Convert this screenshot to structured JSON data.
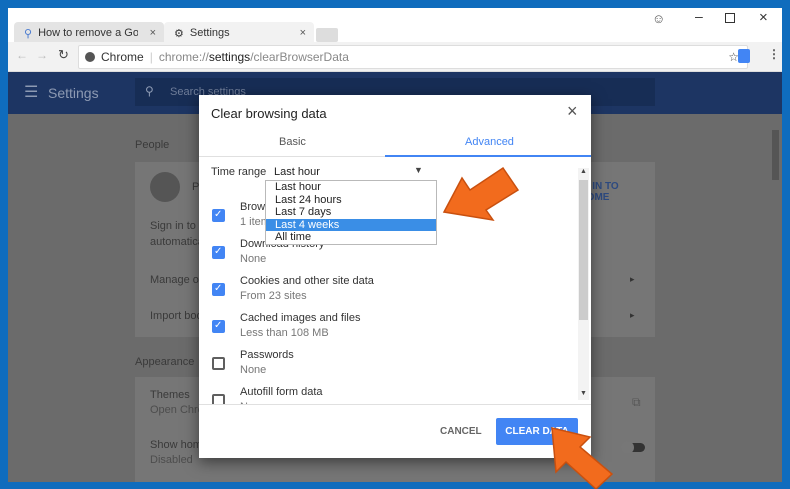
{
  "window": {
    "controls": [
      "account",
      "minimize",
      "maximize",
      "close"
    ]
  },
  "tabs": [
    {
      "label": "How to remove a Google",
      "icon": "pin-icon"
    },
    {
      "label": "Settings",
      "icon": "gear-icon"
    }
  ],
  "toolbar": {
    "site_label": "Chrome",
    "url_prefix": "chrome://",
    "url_bold": "settings",
    "url_suffix": "/clearBrowserData"
  },
  "settings": {
    "title": "Settings",
    "search_placeholder": "Search settings",
    "people_heading": "People",
    "profile_initial": "P",
    "sign_in_button": "SIGN IN TO CHROME",
    "sign_in_text_1": "Sign in to g",
    "sign_in_text_2": "automatica",
    "manage_other": "Manage oth",
    "import_bookmarks": "Import boo",
    "appearance_heading": "Appearance",
    "themes": "Themes",
    "themes_sub": "Open Chro",
    "show_home": "Show home",
    "show_home_sub": "Disabled"
  },
  "dialog": {
    "title": "Clear browsing data",
    "tabs": [
      "Basic",
      "Advanced"
    ],
    "active_tab": "Advanced",
    "time_range_label": "Time range",
    "time_range_value": "Last hour",
    "time_range_options": [
      "Last hour",
      "Last 24 hours",
      "Last 7 days",
      "Last 4 weeks",
      "All time"
    ],
    "highlighted_option": "Last 4 weeks",
    "items": [
      {
        "label": "Browsing history",
        "sub": "1 item",
        "checked": true
      },
      {
        "label": "Download history",
        "sub": "None",
        "checked": true
      },
      {
        "label": "Cookies and other site data",
        "sub": "From 23 sites",
        "checked": true
      },
      {
        "label": "Cached images and files",
        "sub": "Less than 108 MB",
        "checked": true
      },
      {
        "label": "Passwords",
        "sub": "None",
        "checked": false
      },
      {
        "label": "Autofill form data",
        "sub": "None",
        "checked": false
      }
    ],
    "cancel": "CANCEL",
    "clear": "CLEAR DATA"
  },
  "colors": {
    "accent": "#4285f4",
    "arrow": "#f26b1d",
    "frame": "#0f6cbd"
  }
}
